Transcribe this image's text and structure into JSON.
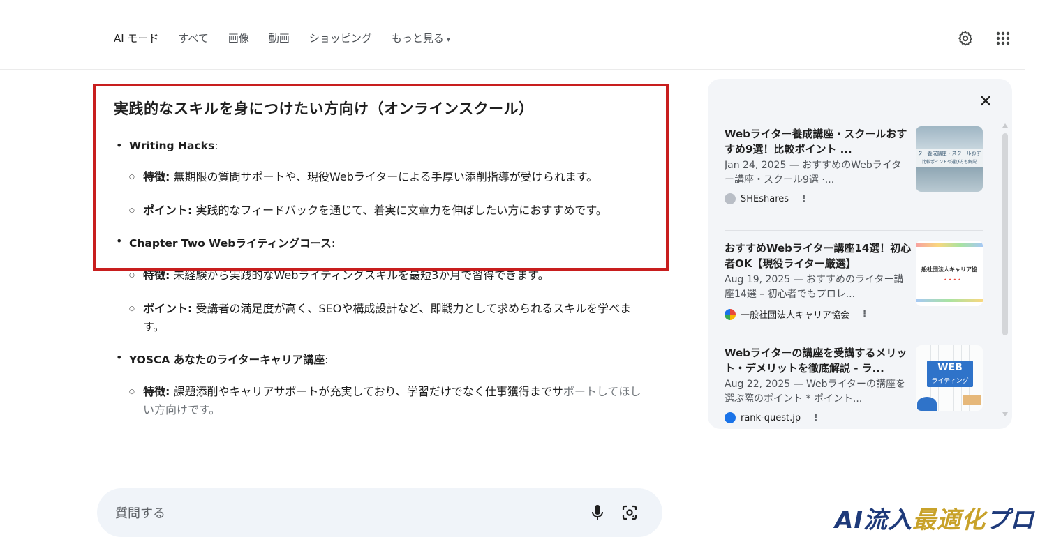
{
  "header": {
    "tabs": [
      {
        "label": "AI モード",
        "active": true
      },
      {
        "label": "すべて"
      },
      {
        "label": "画像"
      },
      {
        "label": "動画"
      },
      {
        "label": "ショッピング"
      },
      {
        "label": "もっと見る"
      }
    ],
    "icons": [
      "settings-gear-icon",
      "apps-grid-icon"
    ]
  },
  "main": {
    "section_title": "実践的なスキルを身につけたい方向け（オンラインスクール）",
    "items": [
      {
        "name": "Writing Hacks",
        "suffix": ":",
        "points": [
          {
            "label": "特徴:",
            "text": " 無期限の質問サポートや、現役Webライターによる手厚い添削指導が受けられます。"
          },
          {
            "label": "ポイント:",
            "text": " 実践的なフィードバックを通じて、着実に文章力を伸ばしたい方におすすめです。"
          }
        ]
      },
      {
        "name": "Chapter Two Webライティングコース",
        "suffix": ":",
        "points": [
          {
            "label": "特徴:",
            "text": " 未経験から実践的なWebライティングスキルを最短3か月で習得できます。"
          },
          {
            "label": "ポイント:",
            "text": " 受講者の満足度が高く、SEOや構成設計など、即戦力として求められるスキルを学べます。"
          }
        ]
      },
      {
        "name": "YOSCA あなたのライターキャリア講座",
        "suffix": ":",
        "points": [
          {
            "label": "特徴:",
            "text_a": " 課題添削やキャリアサポートが充実しており、学習だけでなく仕事獲得までサ",
            "text_b": "ポートしてほしい方向けです。"
          }
        ]
      }
    ]
  },
  "askbox": {
    "placeholder": "質問する",
    "icons": [
      "microphone-icon",
      "lens-camera-icon"
    ]
  },
  "panel": {
    "sources": [
      {
        "title": "Webライター養成講座・スクールおすすめ9選！比較ポイント ...",
        "desc": "Jan 24, 2025 — おすすめのWebライター講座・スクール9選 ·...",
        "site": "SHEshares",
        "thumb_caption": "ター養成講座・スクールおす",
        "thumb_caption2": "比較ポイントや選び方も解説",
        "favicon_color": "#b9bec6"
      },
      {
        "title": "おすすめWebライター講座14選！初心者OK【現役ライター厳選】",
        "desc": "Aug 19, 2025 — おすすめのライター講座14選 – 初心者でもプロレ...",
        "site": "一般社団法人キャリア協会",
        "thumb_caption": "般社団法人キャリア協",
        "favicon_color": "#e8473c"
      },
      {
        "title": "Webライターの講座を受講するメリット・デメリットを徹底解説 - ラ...",
        "desc": "Aug 22, 2025 — Webライターの講座を選ぶ際のポイント * ポイント...",
        "site": "rank-quest.jp",
        "thumb_caption": "WEB",
        "thumb_caption2": "ライティング",
        "favicon_color": "#1a73e8"
      }
    ]
  },
  "watermark": {
    "part_a": "AI流入",
    "part_b": "最適化",
    "part_c": "プロ"
  }
}
